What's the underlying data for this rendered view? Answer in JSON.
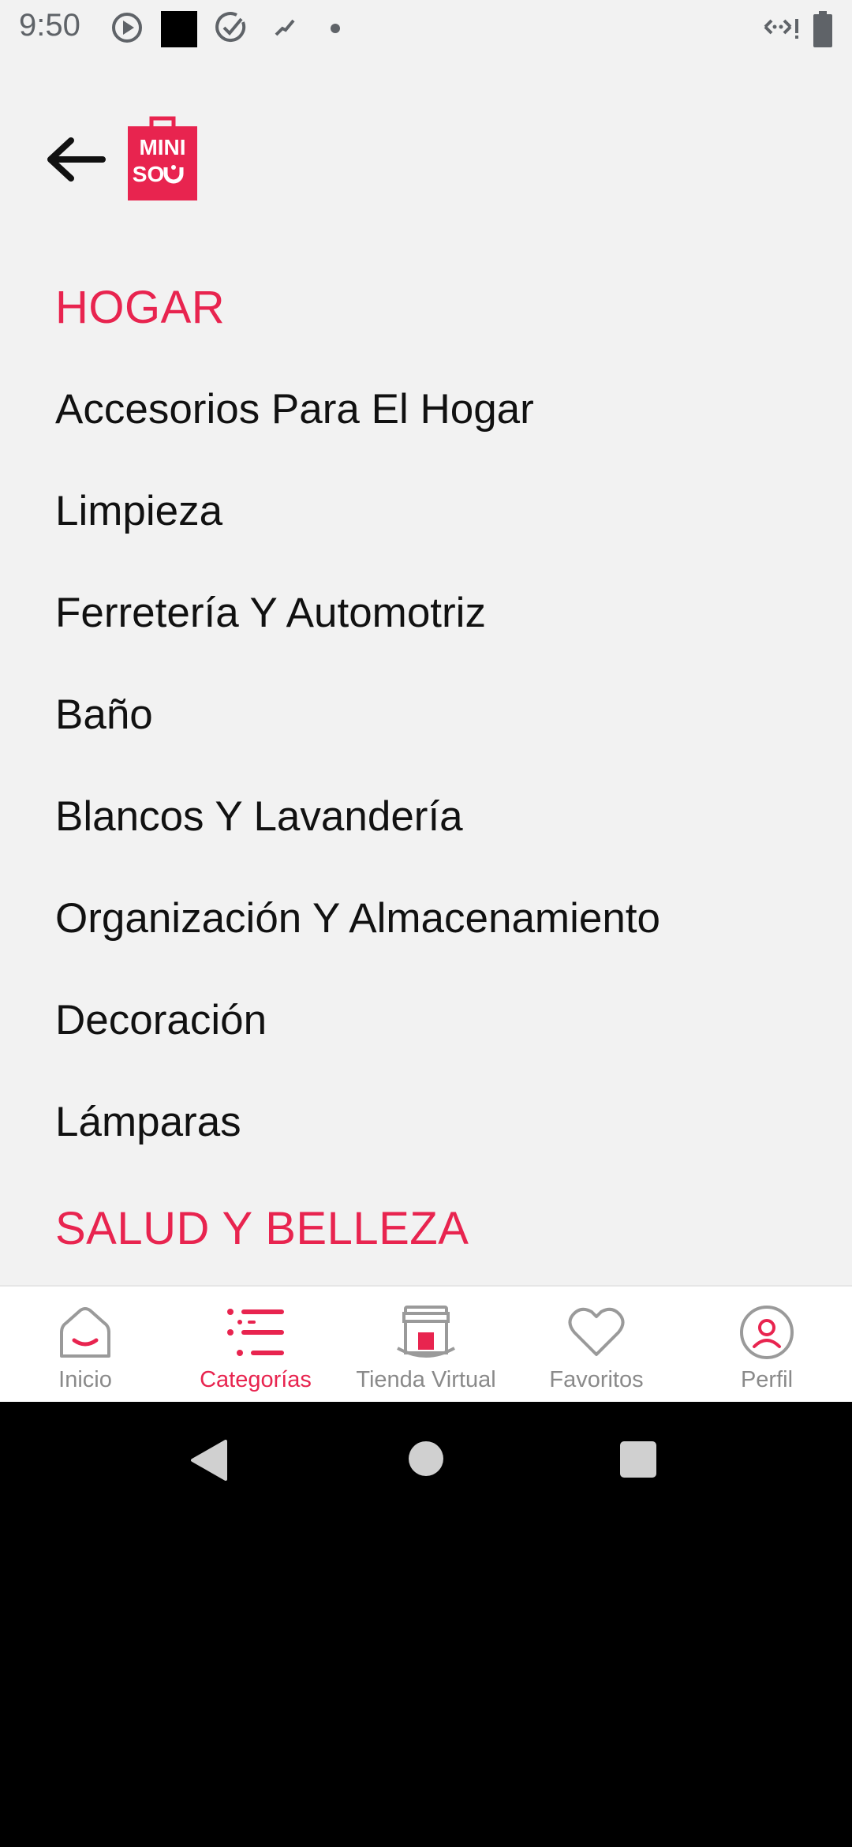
{
  "status_bar": {
    "time": "9:50",
    "icons": [
      "play-circle-icon",
      "black-square-icon",
      "check-circle-icon",
      "slash-icon",
      "dot-icon",
      "data-transfer-icon",
      "battery-icon"
    ]
  },
  "header": {
    "back_icon": "arrow-left-icon",
    "logo_text_line1": "MINI",
    "logo_text_line2": "SO",
    "brand_color": "#e8244f"
  },
  "sections": [
    {
      "title": "HOGAR",
      "items": [
        "Accesorios Para El Hogar",
        "Limpieza",
        "Ferretería Y Automotriz",
        "Baño",
        "Blancos Y Lavandería",
        "Organización Y Almacenamiento",
        "Decoración",
        "Lámparas"
      ]
    },
    {
      "title": "SALUD Y BELLEZA",
      "items": []
    }
  ],
  "bottom_nav": {
    "items": [
      {
        "label": "Inicio",
        "icon": "home-smile-icon",
        "active": false
      },
      {
        "label": "Categorías",
        "icon": "list-icon",
        "active": true
      },
      {
        "label": "Tienda Virtual",
        "icon": "store-icon",
        "active": false
      },
      {
        "label": "Favoritos",
        "icon": "heart-icon",
        "active": false
      },
      {
        "label": "Perfil",
        "icon": "profile-icon",
        "active": false
      }
    ],
    "active_color": "#e8244f",
    "inactive_color": "#8a8a8a"
  },
  "system_nav": {
    "buttons": [
      "back-triangle-icon",
      "home-circle-icon",
      "recents-square-icon"
    ]
  }
}
